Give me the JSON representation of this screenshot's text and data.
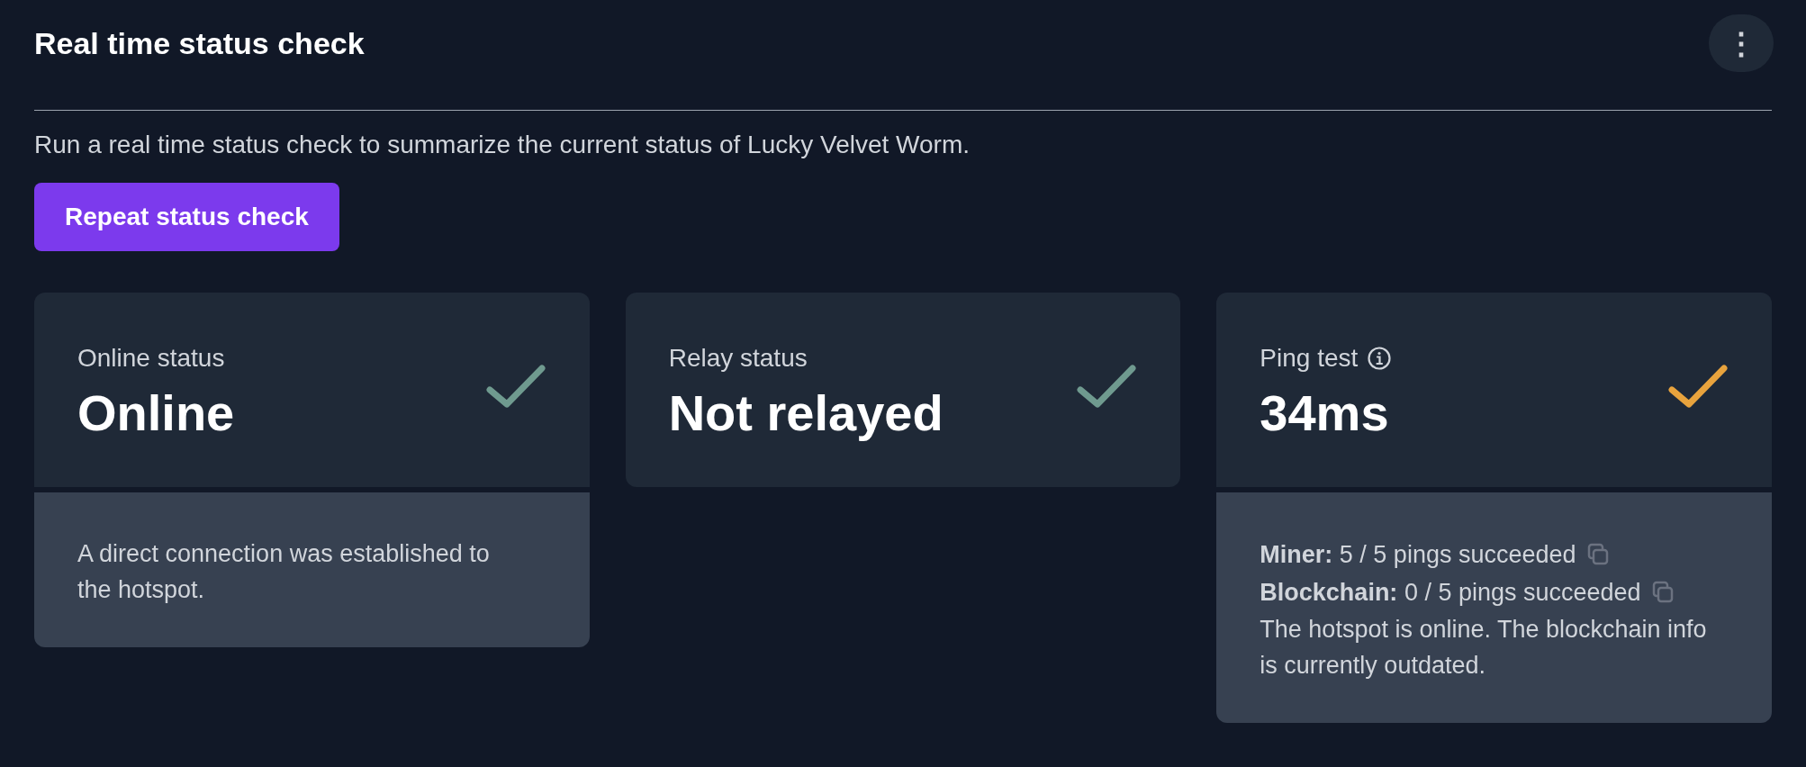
{
  "header": {
    "title": "Real time status check",
    "menu_button": "⋮"
  },
  "description": "Run a real time status check to summarize the current status of Lucky Velvet Worm.",
  "action_button": "Repeat status check",
  "cards": [
    {
      "label": "Online status",
      "info": false,
      "value": "Online",
      "color": "#6f9a8f",
      "details": [
        {
          "kind": "paragraph",
          "text": "A direct connection was established to the hotspot."
        }
      ]
    },
    {
      "label": "Relay status",
      "info": false,
      "value": "Not relayed",
      "color": "#6f9a8f"
    },
    {
      "label": "Ping test",
      "info": true,
      "value": "34ms",
      "color": "#e8a33d",
      "details": [
        {
          "kind": "copyable",
          "text": "**Miner:** 5 / 5 pings succeeded"
        },
        {
          "kind": "copyable",
          "text": "**Blockchain:** 0 / 5 pings succeeded"
        },
        {
          "kind": "paragraph",
          "text": "The hotspot is online. The blockchain info is currently outdated."
        }
      ]
    }
  ]
}
